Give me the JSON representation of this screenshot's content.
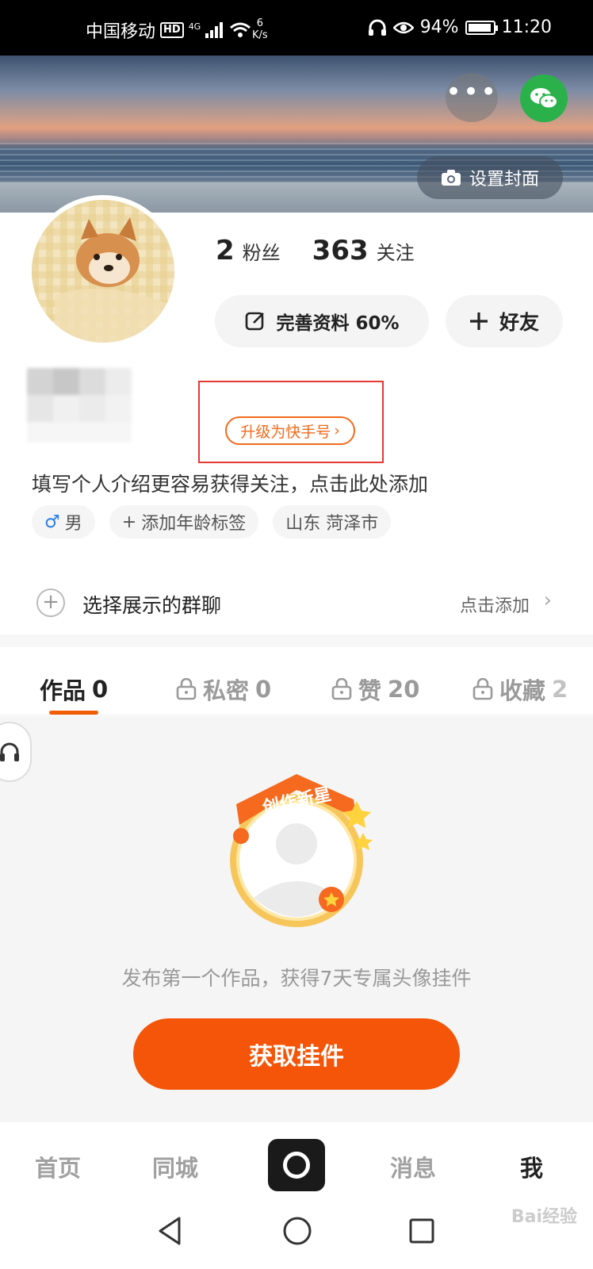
{
  "status_bar": {
    "carrier": "中国移动",
    "hd": "HD",
    "network": "4G",
    "speed_value": "6",
    "speed_unit": "K/s",
    "battery": "94%",
    "time": "11:20"
  },
  "header": {
    "cover_button": "设置封面",
    "more_icon": "more-dots-icon",
    "share_icon": "wechat-icon"
  },
  "profile": {
    "followers_count": "2",
    "followers_label": "粉丝",
    "following_count": "363",
    "following_label": "关注",
    "complete_profile_button": "完善资料 60%",
    "add_friend_button": "好友",
    "upgrade_link": "升级为快手号",
    "bio_placeholder": "填写个人介绍更容易获得关注，点击此处添加",
    "tags": [
      {
        "icon": "male-icon",
        "label": "男"
      },
      {
        "icon": "plus-icon",
        "label": "添加年龄标签"
      },
      {
        "icon": "",
        "label": "山东 菏泽市"
      }
    ]
  },
  "group_chat": {
    "label": "选择展示的群聊",
    "action": "点击添加"
  },
  "tabs": [
    {
      "label": "作品",
      "count": "0",
      "locked": false,
      "active": true
    },
    {
      "label": "私密",
      "count": "0",
      "locked": true,
      "active": false
    },
    {
      "label": "赞",
      "count": "20",
      "locked": true,
      "active": false
    },
    {
      "label": "收藏",
      "count": "2",
      "locked": true,
      "active": false
    }
  ],
  "promo": {
    "badge": "创作新星",
    "text": "发布第一个作品，获得7天专属头像挂件",
    "button": "获取挂件"
  },
  "bottom_nav": {
    "home": "首页",
    "local": "同城",
    "messages": "消息",
    "me": "我"
  },
  "watermark": "Bai经验",
  "colors": {
    "accent": "#f45508",
    "highlight_box": "#e53935",
    "wechat": "#2ab14a"
  }
}
